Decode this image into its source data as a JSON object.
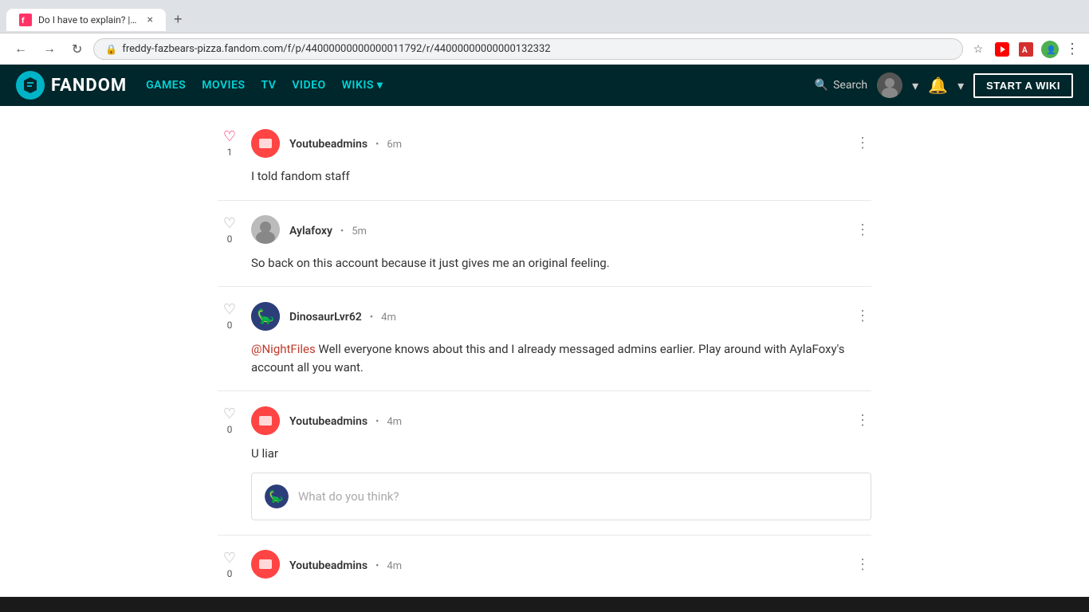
{
  "browser": {
    "tab_title": "Do I have to explain? | Fandom",
    "tab_close": "×",
    "new_tab": "+",
    "url": "freddy-fazbears-pizza.fandom.com/f/p/44000000000000011792/r/44000000000000132332",
    "nav_back": "←",
    "nav_forward": "→",
    "nav_refresh": "↻",
    "lock_icon": "🔒"
  },
  "fandom_nav": {
    "logo_text": "FANDOM",
    "links": [
      "GAMES",
      "MOVIES",
      "TV",
      "VIDEO",
      "WIKIS"
    ],
    "search_label": "Search",
    "start_wiki_btn": "START A WIKI"
  },
  "comments": [
    {
      "id": "comment1",
      "username": "Youtubeadmins",
      "time": "6m",
      "liked": true,
      "like_count": "1",
      "avatar_type": "red",
      "body": "I told fandom staff"
    },
    {
      "id": "comment2",
      "username": "Aylafoxy",
      "time": "5m",
      "liked": false,
      "like_count": "0",
      "avatar_type": "gray",
      "body": "So back on this account because it just gives me an original feeling."
    },
    {
      "id": "comment3",
      "username": "DinosaurLvr62",
      "time": "4m",
      "liked": false,
      "like_count": "0",
      "avatar_type": "dino",
      "mention": "@NightFiles",
      "body_after_mention": " Well everyone knows about this and I already messaged admins earlier. Play around with AylaFoxy's account all you want."
    },
    {
      "id": "comment4",
      "username": "Youtubeadmins",
      "time": "4m",
      "liked": false,
      "like_count": "0",
      "avatar_type": "red",
      "body": "U liar"
    },
    {
      "id": "comment5_partial",
      "username": "Youtubeadmins",
      "time": "4m",
      "liked": false,
      "like_count": "0",
      "avatar_type": "red",
      "body": ""
    }
  ],
  "reply_input": {
    "placeholder": "What do you think?"
  }
}
